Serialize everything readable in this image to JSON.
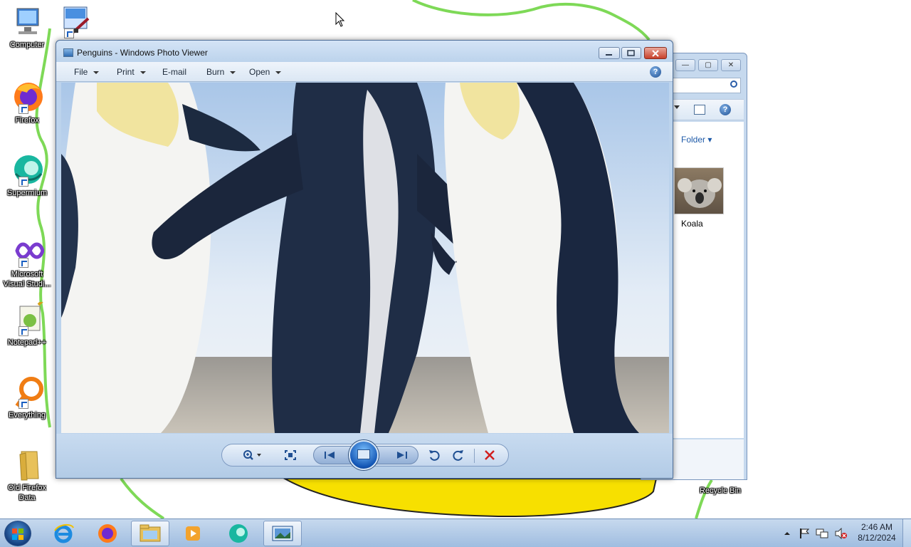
{
  "desktop": {
    "icons": [
      {
        "label": "Computer",
        "icon": "computer-icon"
      },
      {
        "label": "Firefox",
        "icon": "firefox-icon"
      },
      {
        "label": "Supermium",
        "icon": "supermium-icon"
      },
      {
        "label": "Microsoft Visual Studi...",
        "icon": "visual-studio-icon"
      },
      {
        "label": "Notepad++",
        "icon": "notepadpp-icon"
      },
      {
        "label": "Everything",
        "icon": "everything-icon"
      },
      {
        "label": "Old Firefox Data",
        "icon": "folder-icon"
      },
      {
        "label": "Recycle Bin",
        "icon": "recycle-bin-icon"
      }
    ]
  },
  "explorer": {
    "folder_button": "Folder",
    "items": [
      {
        "label": "Koala",
        "icon": "koala-thumbnail"
      }
    ]
  },
  "viewer": {
    "title": "Penguins - Windows Photo Viewer",
    "menu": [
      {
        "label": "File",
        "has_dropdown": true
      },
      {
        "label": "Print",
        "has_dropdown": true
      },
      {
        "label": "E-mail",
        "has_dropdown": false
      },
      {
        "label": "Burn",
        "has_dropdown": true
      },
      {
        "label": "Open",
        "has_dropdown": true
      }
    ],
    "help_label": "?",
    "photo": "penguins-image",
    "controls": [
      "zoom-icon",
      "actual-size-icon",
      "previous-icon",
      "slideshow-icon",
      "next-icon",
      "rotate-left-icon",
      "rotate-right-icon",
      "delete-icon"
    ]
  },
  "taskbar": {
    "items": [
      "internet-explorer-icon",
      "firefox-icon",
      "explorer-icon",
      "media-player-icon",
      "supermium-icon",
      "photo-viewer-icon"
    ],
    "tray_icons": [
      "show-hidden-icon",
      "action-center-flag-icon",
      "network-icon",
      "volume-muted-icon"
    ],
    "clock_time": "2:46 AM",
    "clock_date": "8/12/2024"
  },
  "colors": {
    "accent": "#bcd3ec",
    "wallpaper_line": "#7ed957",
    "wallpaper_shape": "#f7e000",
    "close_button": "#c8402a"
  }
}
